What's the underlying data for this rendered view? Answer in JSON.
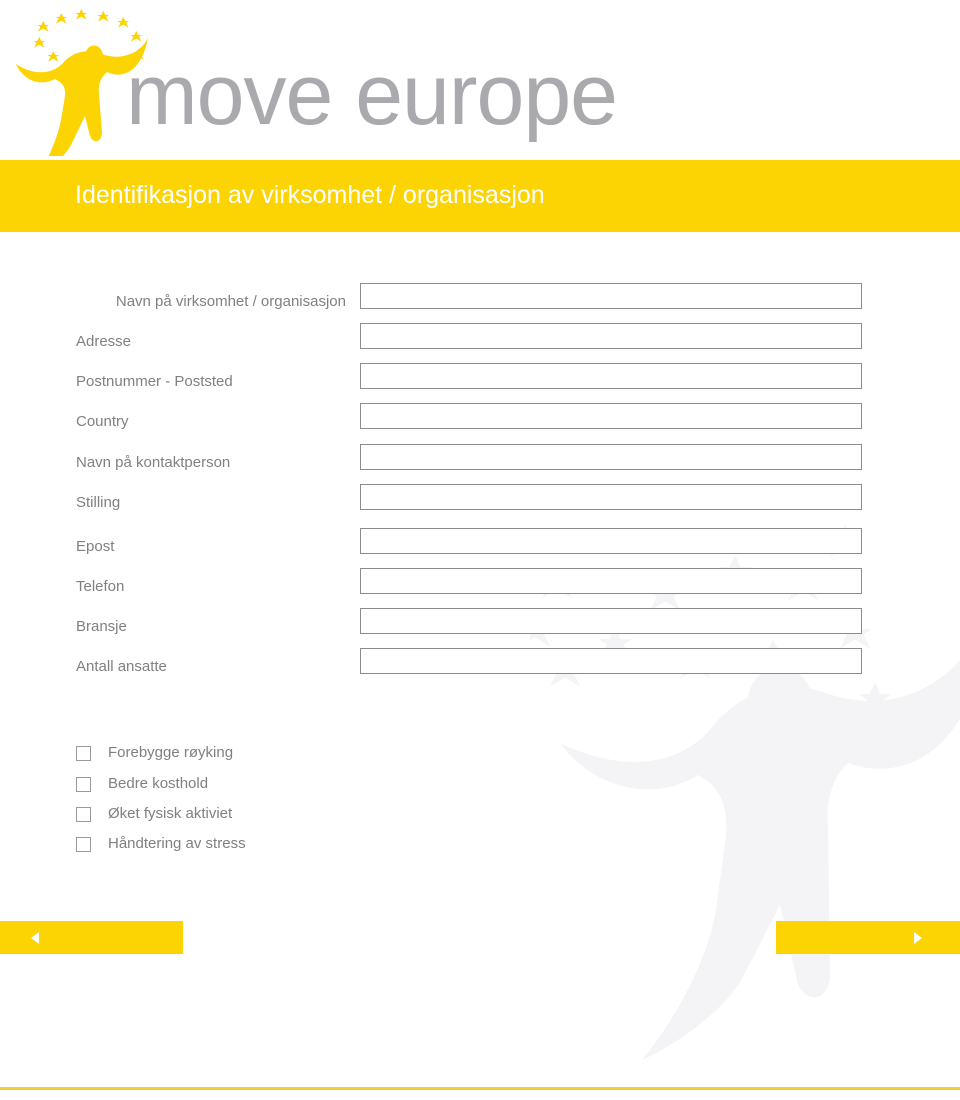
{
  "logo": {
    "wordmark": "move europe",
    "mark_name": "move-europe-figure-stars",
    "brand_yellow": "#fcd404",
    "wordmark_gray": "#a9a9ae"
  },
  "header": {
    "title": "Identifikasjon av virksomhet / organisasjon",
    "background": "#fcd404",
    "text_color": "#ffffff"
  },
  "form": {
    "fields": [
      {
        "label": "Navn på virksomhet / organisasjon",
        "value": "",
        "placeholder": ""
      },
      {
        "label": "Adresse",
        "value": "",
        "placeholder": ""
      },
      {
        "label": "Postnummer - Poststed",
        "value": "",
        "placeholder": ""
      },
      {
        "label": "Country",
        "value": "",
        "placeholder": ""
      },
      {
        "label": "Navn på kontaktperson",
        "value": "",
        "placeholder": ""
      },
      {
        "label": "Stilling",
        "value": "",
        "placeholder": ""
      },
      {
        "label": "Epost",
        "value": "",
        "placeholder": ""
      },
      {
        "label": "Telefon",
        "value": "",
        "placeholder": ""
      },
      {
        "label": "Bransje",
        "value": "",
        "placeholder": ""
      },
      {
        "label": "Antall ansatte",
        "value": "",
        "placeholder": ""
      }
    ]
  },
  "checkboxes": {
    "items": [
      {
        "label": "Forebygge røyking",
        "checked": false
      },
      {
        "label": "Bedre kosthold",
        "checked": false
      },
      {
        "label": "Øket fysisk aktiviet",
        "checked": false
      },
      {
        "label": "Håndtering av stress",
        "checked": false
      }
    ]
  },
  "navigation": {
    "prev_icon": "triangle-left-icon",
    "next_icon": "triangle-right-icon",
    "prev_label": "",
    "next_label": ""
  }
}
